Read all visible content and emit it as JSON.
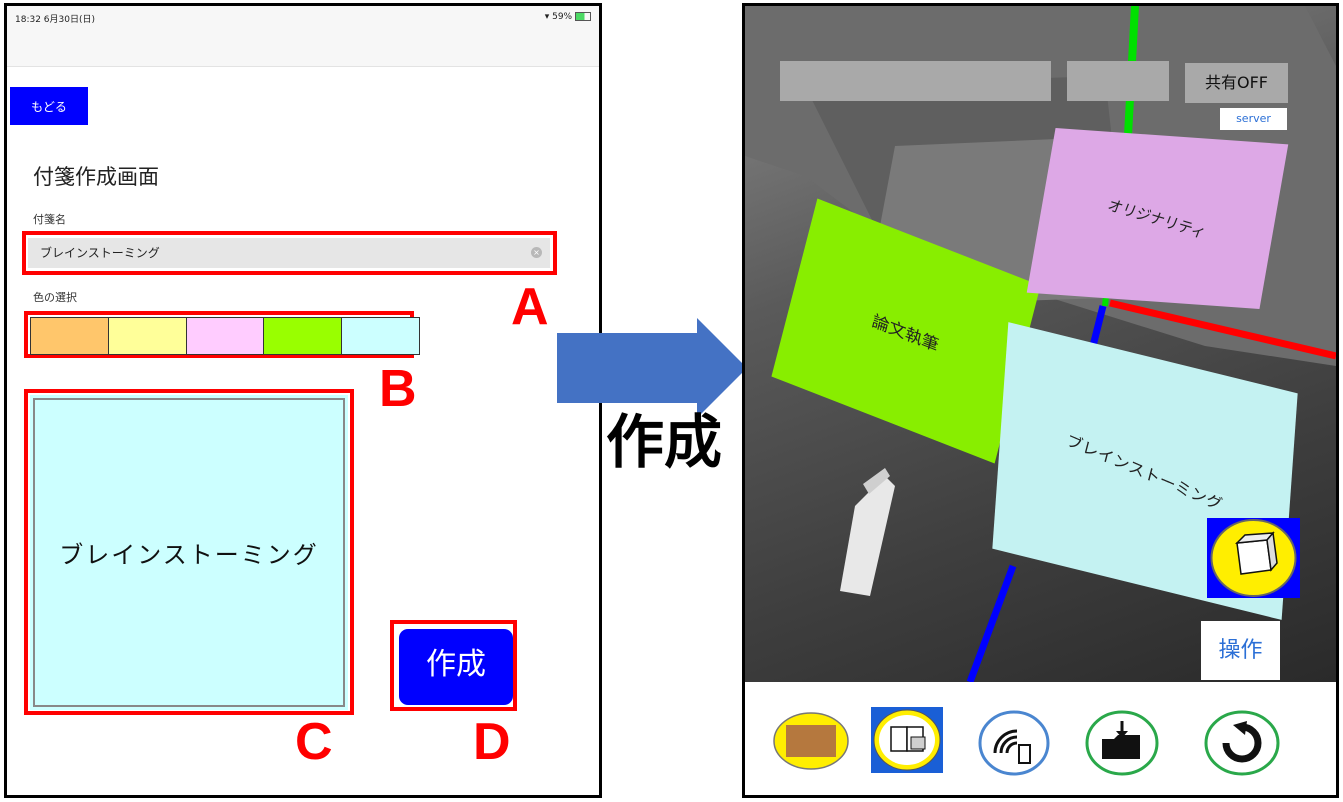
{
  "left_screen": {
    "status_time": "18:32  6月30日(日)",
    "status_right": "59%",
    "back_label": "もどる",
    "title": "付箋作成画面",
    "name_label": "付箋名",
    "name_value": "ブレインストーミング",
    "color_label": "色の選択",
    "swatches": [
      "#ffc66b",
      "#ffff99",
      "#ffccff",
      "#99ff00",
      "#ccffff"
    ],
    "preview_text": "ブレインストーミング",
    "preview_color": "#ccffff",
    "create_label": "作成",
    "callouts": {
      "a": "A",
      "b": "B",
      "c": "C",
      "d": "D"
    }
  },
  "arrow_label": "作成",
  "right_screen": {
    "share_label": "共有OFF",
    "server_label": "server",
    "notes": [
      {
        "text": "論文執筆",
        "color": "#88ee00"
      },
      {
        "text": "オリジナリティ",
        "color": "#dda8e6"
      },
      {
        "text": "ブレインストーミング",
        "color": "#c4f2f2"
      }
    ],
    "operate_label": "操作",
    "toolbar_icons": [
      "cork-board-icon",
      "notebook-photo-icon",
      "wifi-device-icon",
      "download-folder-icon",
      "refresh-icon"
    ]
  }
}
